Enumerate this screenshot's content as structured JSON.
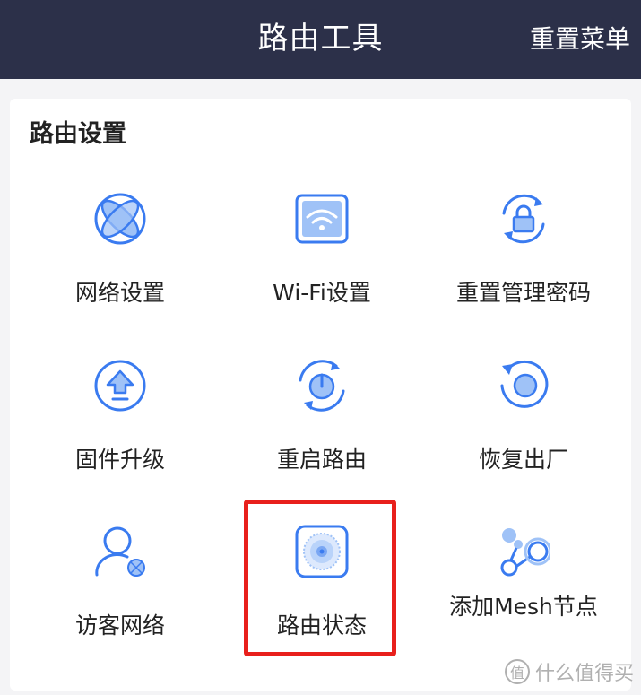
{
  "header": {
    "title": "路由工具",
    "reset_menu_label": "重置菜单"
  },
  "section": {
    "title": "路由设置"
  },
  "tiles": [
    {
      "label": "网络设置",
      "icon": "network-globe-icon"
    },
    {
      "label": "Wi-Fi设置",
      "icon": "wifi-icon"
    },
    {
      "label": "重置管理密码",
      "icon": "reset-password-lock-icon"
    },
    {
      "label": "固件升级",
      "icon": "firmware-upgrade-icon"
    },
    {
      "label": "重启路由",
      "icon": "power-restart-icon"
    },
    {
      "label": "恢复出厂",
      "icon": "factory-reset-icon"
    },
    {
      "label": "访客网络",
      "icon": "guest-user-icon"
    },
    {
      "label": "路由状态",
      "icon": "router-status-icon"
    },
    {
      "label": "添加Mesh节点",
      "icon": "mesh-node-icon"
    }
  ],
  "watermark": {
    "text": "什么值得买",
    "mark": "值"
  },
  "colors": {
    "header_bg": "#2c3049",
    "accent": "#3a7bf0",
    "accent_light": "#9fc2f7",
    "highlight": "#e8201c"
  }
}
